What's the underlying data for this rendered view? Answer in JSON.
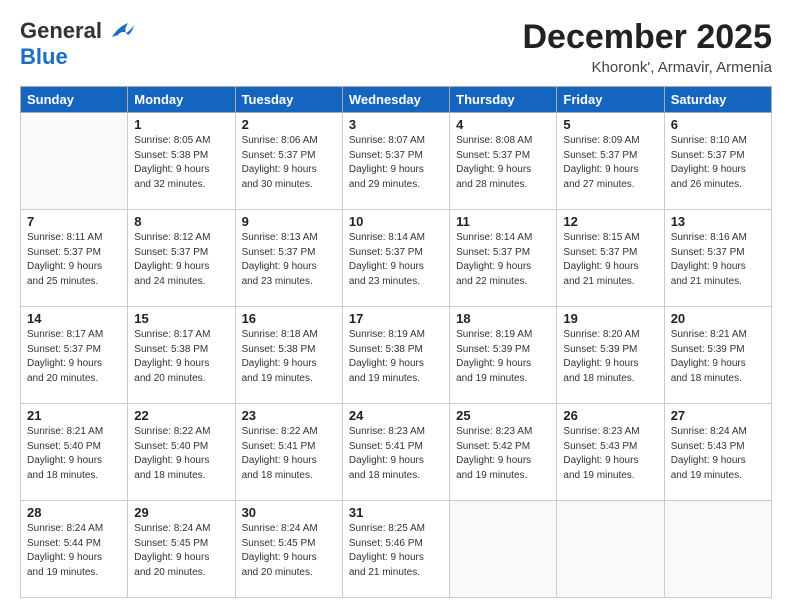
{
  "header": {
    "logo_general": "General",
    "logo_blue": "Blue",
    "month_title": "December 2025",
    "location": "Khoronk', Armavir, Armenia"
  },
  "days_of_week": [
    "Sunday",
    "Monday",
    "Tuesday",
    "Wednesday",
    "Thursday",
    "Friday",
    "Saturday"
  ],
  "weeks": [
    [
      {
        "day": "",
        "sunrise": "",
        "sunset": "",
        "daylight": ""
      },
      {
        "day": "1",
        "sunrise": "Sunrise: 8:05 AM",
        "sunset": "Sunset: 5:38 PM",
        "daylight": "Daylight: 9 hours and 32 minutes."
      },
      {
        "day": "2",
        "sunrise": "Sunrise: 8:06 AM",
        "sunset": "Sunset: 5:37 PM",
        "daylight": "Daylight: 9 hours and 30 minutes."
      },
      {
        "day": "3",
        "sunrise": "Sunrise: 8:07 AM",
        "sunset": "Sunset: 5:37 PM",
        "daylight": "Daylight: 9 hours and 29 minutes."
      },
      {
        "day": "4",
        "sunrise": "Sunrise: 8:08 AM",
        "sunset": "Sunset: 5:37 PM",
        "daylight": "Daylight: 9 hours and 28 minutes."
      },
      {
        "day": "5",
        "sunrise": "Sunrise: 8:09 AM",
        "sunset": "Sunset: 5:37 PM",
        "daylight": "Daylight: 9 hours and 27 minutes."
      },
      {
        "day": "6",
        "sunrise": "Sunrise: 8:10 AM",
        "sunset": "Sunset: 5:37 PM",
        "daylight": "Daylight: 9 hours and 26 minutes."
      }
    ],
    [
      {
        "day": "7",
        "sunrise": "Sunrise: 8:11 AM",
        "sunset": "Sunset: 5:37 PM",
        "daylight": "Daylight: 9 hours and 25 minutes."
      },
      {
        "day": "8",
        "sunrise": "Sunrise: 8:12 AM",
        "sunset": "Sunset: 5:37 PM",
        "daylight": "Daylight: 9 hours and 24 minutes."
      },
      {
        "day": "9",
        "sunrise": "Sunrise: 8:13 AM",
        "sunset": "Sunset: 5:37 PM",
        "daylight": "Daylight: 9 hours and 23 minutes."
      },
      {
        "day": "10",
        "sunrise": "Sunrise: 8:14 AM",
        "sunset": "Sunset: 5:37 PM",
        "daylight": "Daylight: 9 hours and 23 minutes."
      },
      {
        "day": "11",
        "sunrise": "Sunrise: 8:14 AM",
        "sunset": "Sunset: 5:37 PM",
        "daylight": "Daylight: 9 hours and 22 minutes."
      },
      {
        "day": "12",
        "sunrise": "Sunrise: 8:15 AM",
        "sunset": "Sunset: 5:37 PM",
        "daylight": "Daylight: 9 hours and 21 minutes."
      },
      {
        "day": "13",
        "sunrise": "Sunrise: 8:16 AM",
        "sunset": "Sunset: 5:37 PM",
        "daylight": "Daylight: 9 hours and 21 minutes."
      }
    ],
    [
      {
        "day": "14",
        "sunrise": "Sunrise: 8:17 AM",
        "sunset": "Sunset: 5:37 PM",
        "daylight": "Daylight: 9 hours and 20 minutes."
      },
      {
        "day": "15",
        "sunrise": "Sunrise: 8:17 AM",
        "sunset": "Sunset: 5:38 PM",
        "daylight": "Daylight: 9 hours and 20 minutes."
      },
      {
        "day": "16",
        "sunrise": "Sunrise: 8:18 AM",
        "sunset": "Sunset: 5:38 PM",
        "daylight": "Daylight: 9 hours and 19 minutes."
      },
      {
        "day": "17",
        "sunrise": "Sunrise: 8:19 AM",
        "sunset": "Sunset: 5:38 PM",
        "daylight": "Daylight: 9 hours and 19 minutes."
      },
      {
        "day": "18",
        "sunrise": "Sunrise: 8:19 AM",
        "sunset": "Sunset: 5:39 PM",
        "daylight": "Daylight: 9 hours and 19 minutes."
      },
      {
        "day": "19",
        "sunrise": "Sunrise: 8:20 AM",
        "sunset": "Sunset: 5:39 PM",
        "daylight": "Daylight: 9 hours and 18 minutes."
      },
      {
        "day": "20",
        "sunrise": "Sunrise: 8:21 AM",
        "sunset": "Sunset: 5:39 PM",
        "daylight": "Daylight: 9 hours and 18 minutes."
      }
    ],
    [
      {
        "day": "21",
        "sunrise": "Sunrise: 8:21 AM",
        "sunset": "Sunset: 5:40 PM",
        "daylight": "Daylight: 9 hours and 18 minutes."
      },
      {
        "day": "22",
        "sunrise": "Sunrise: 8:22 AM",
        "sunset": "Sunset: 5:40 PM",
        "daylight": "Daylight: 9 hours and 18 minutes."
      },
      {
        "day": "23",
        "sunrise": "Sunrise: 8:22 AM",
        "sunset": "Sunset: 5:41 PM",
        "daylight": "Daylight: 9 hours and 18 minutes."
      },
      {
        "day": "24",
        "sunrise": "Sunrise: 8:23 AM",
        "sunset": "Sunset: 5:41 PM",
        "daylight": "Daylight: 9 hours and 18 minutes."
      },
      {
        "day": "25",
        "sunrise": "Sunrise: 8:23 AM",
        "sunset": "Sunset: 5:42 PM",
        "daylight": "Daylight: 9 hours and 19 minutes."
      },
      {
        "day": "26",
        "sunrise": "Sunrise: 8:23 AM",
        "sunset": "Sunset: 5:43 PM",
        "daylight": "Daylight: 9 hours and 19 minutes."
      },
      {
        "day": "27",
        "sunrise": "Sunrise: 8:24 AM",
        "sunset": "Sunset: 5:43 PM",
        "daylight": "Daylight: 9 hours and 19 minutes."
      }
    ],
    [
      {
        "day": "28",
        "sunrise": "Sunrise: 8:24 AM",
        "sunset": "Sunset: 5:44 PM",
        "daylight": "Daylight: 9 hours and 19 minutes."
      },
      {
        "day": "29",
        "sunrise": "Sunrise: 8:24 AM",
        "sunset": "Sunset: 5:45 PM",
        "daylight": "Daylight: 9 hours and 20 minutes."
      },
      {
        "day": "30",
        "sunrise": "Sunrise: 8:24 AM",
        "sunset": "Sunset: 5:45 PM",
        "daylight": "Daylight: 9 hours and 20 minutes."
      },
      {
        "day": "31",
        "sunrise": "Sunrise: 8:25 AM",
        "sunset": "Sunset: 5:46 PM",
        "daylight": "Daylight: 9 hours and 21 minutes."
      },
      {
        "day": "",
        "sunrise": "",
        "sunset": "",
        "daylight": ""
      },
      {
        "day": "",
        "sunrise": "",
        "sunset": "",
        "daylight": ""
      },
      {
        "day": "",
        "sunrise": "",
        "sunset": "",
        "daylight": ""
      }
    ]
  ]
}
